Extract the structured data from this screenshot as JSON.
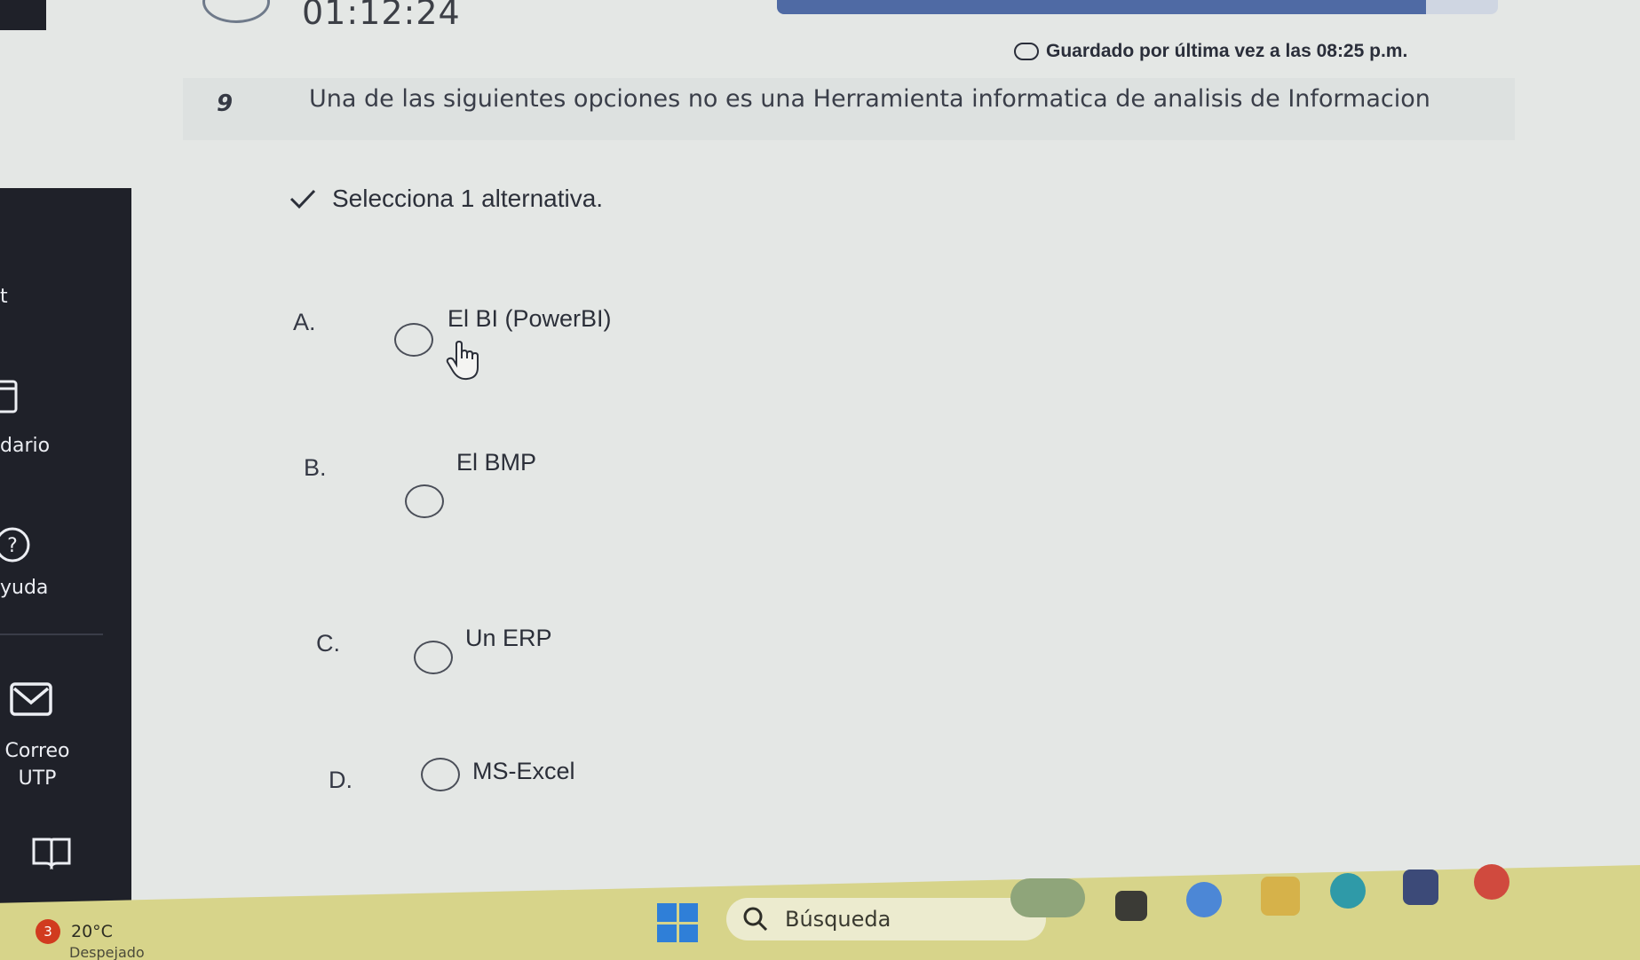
{
  "header": {
    "timer": "01:12:24",
    "progress_fraction": 0.9,
    "saved_text": "Guardado por última vez a las 08:25 p.m."
  },
  "sidebar": {
    "items": [
      {
        "label": "t",
        "icon": "unknown-icon"
      },
      {
        "label": "dario",
        "icon": "calendar-icon"
      },
      {
        "label": "yuda",
        "icon": "help-icon"
      },
      {
        "label": "Correo",
        "label2": "UTP",
        "icon": "mail-icon"
      },
      {
        "label": "",
        "icon": "book-icon"
      }
    ]
  },
  "question": {
    "number": "9",
    "text": "Una de las siguientes opciones no es una Herramienta informatica de analisis de Informacion",
    "instruction": "Selecciona 1 alternativa.",
    "options": [
      {
        "letter": "A.",
        "text": "El BI (PowerBI)"
      },
      {
        "letter": "B.",
        "text": "El BMP"
      },
      {
        "letter": "C.",
        "text": "Un ERP"
      },
      {
        "letter": "D.",
        "text": "MS-Excel"
      }
    ]
  },
  "taskbar": {
    "weather_badge": "3",
    "temperature": "20°C",
    "weather_desc": "Despejado",
    "search_label": "Búsqueda"
  },
  "colors": {
    "sidebar_bg": "#1f2129",
    "progress_fill": "#4f6aa4",
    "taskbar_bg": "#d7d48a"
  }
}
